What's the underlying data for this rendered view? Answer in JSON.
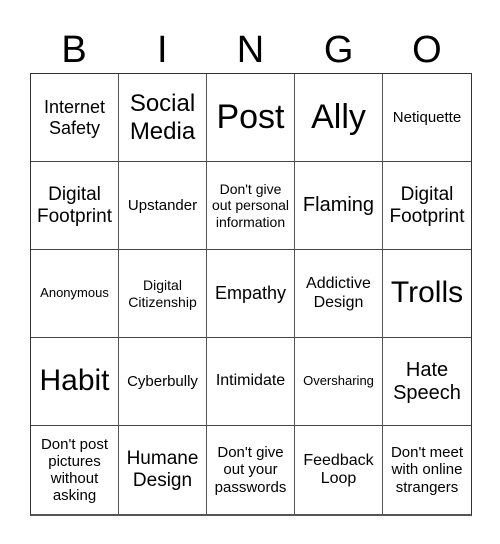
{
  "header": [
    "B",
    "I",
    "N",
    "G",
    "O"
  ],
  "cells": [
    [
      "Internet Safety",
      "Social Media",
      "Post",
      "Ally",
      "Netiquette"
    ],
    [
      "Digital Footprint",
      "Upstander",
      "Don't give out personal information",
      "Flaming",
      "Digital Footprint"
    ],
    [
      "Anonymous",
      "Digital Citizenship",
      "Empathy",
      "Addictive Design",
      "Trolls"
    ],
    [
      "Habit",
      "Cyberbully",
      "Intimidate",
      "Oversharing",
      "Hate Speech"
    ],
    [
      "Don't post pictures without asking",
      "Humane Design",
      "Don't give out your passwords",
      "Feedback Loop",
      "Don't meet with online strangers"
    ]
  ]
}
